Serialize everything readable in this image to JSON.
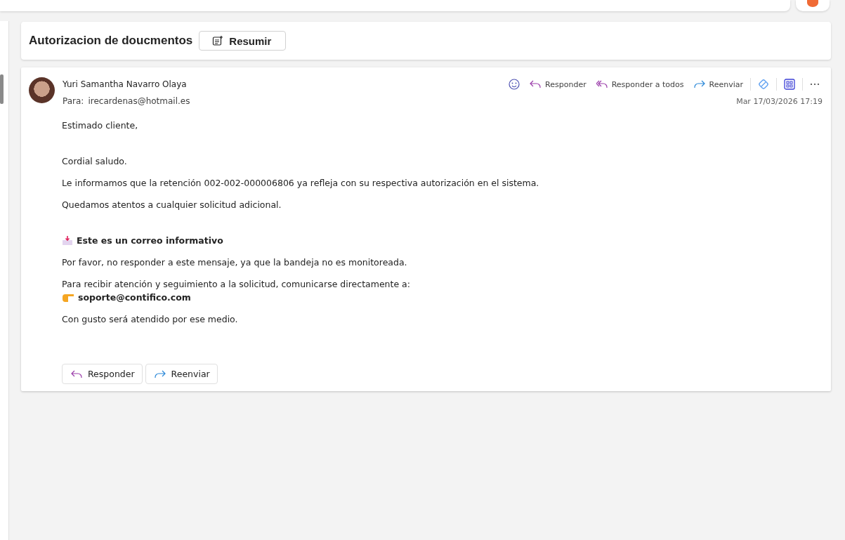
{
  "subject": "Autorizacion de doucmentos",
  "summarize_button": "Resumir",
  "message": {
    "sender": "Yuri Samantha Navarro Olaya",
    "to_label": "Para:",
    "to": "irecardenas@hotmail.es",
    "date": "Mar 17/03/2026 17:19",
    "actions": [
      {
        "kind": "reply",
        "label": "Responder"
      },
      {
        "kind": "reply-all",
        "label": "Responder a todos"
      },
      {
        "kind": "forward",
        "label": "Reenviar"
      }
    ],
    "body": [
      {
        "kind": "spaced-p",
        "text": "Estimado cliente,"
      },
      {
        "kind": "p",
        "text": "Cordial saludo."
      },
      {
        "kind": "p",
        "text": "Le informamos que la retención 002-002-000006806 ya refleja con su respectiva autorización en el sistema."
      },
      {
        "kind": "spaced-p",
        "text": "Quedamos atentos a cualquier solicitud adicional."
      },
      {
        "kind": "heading",
        "text": "Este es un correo informativo"
      },
      {
        "kind": "p",
        "text": "Por favor, no responder a este mensaje, ya que la bandeja no es monitoreada."
      },
      {
        "kind": "p",
        "text": "Para recibir atención y seguimiento a la solicitud, comunicarse directamente a:"
      },
      {
        "kind": "contact",
        "text": "soporte@contifico.com"
      },
      {
        "kind": "p",
        "text": "Con gusto será atendido por ese medio."
      }
    ],
    "footer_buttons": [
      {
        "kind": "reply",
        "label": "Responder"
      },
      {
        "kind": "forward",
        "label": "Reenviar"
      }
    ]
  }
}
